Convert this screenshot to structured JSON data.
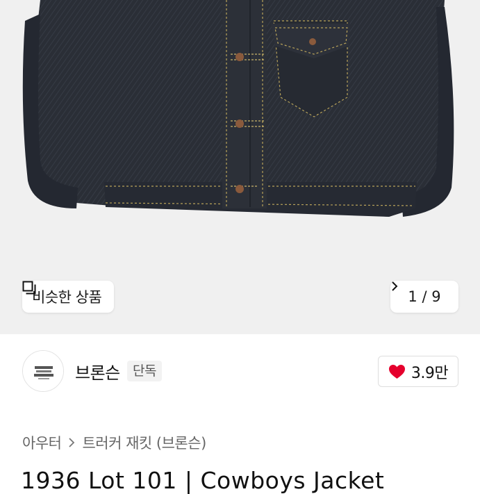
{
  "gallery": {
    "similar_label": "비슷한 상품",
    "page_indicator": "1 / 9",
    "similar_icon": "similar-products-icon",
    "next_icon": "chevron-right-icon"
  },
  "store": {
    "name": "브론슨",
    "badge": "단독",
    "avatar_icon": "store-logo",
    "like_count": "3.9만",
    "like_icon": "heart-icon",
    "like_color": "#e5002d"
  },
  "breadcrumb": {
    "items": [
      "아우터",
      "트러커 재킷 (브론슨)"
    ],
    "separator_icon": "chevron-right-icon"
  },
  "product": {
    "title": "1936 Lot 101 | Cowboys Jacket"
  }
}
